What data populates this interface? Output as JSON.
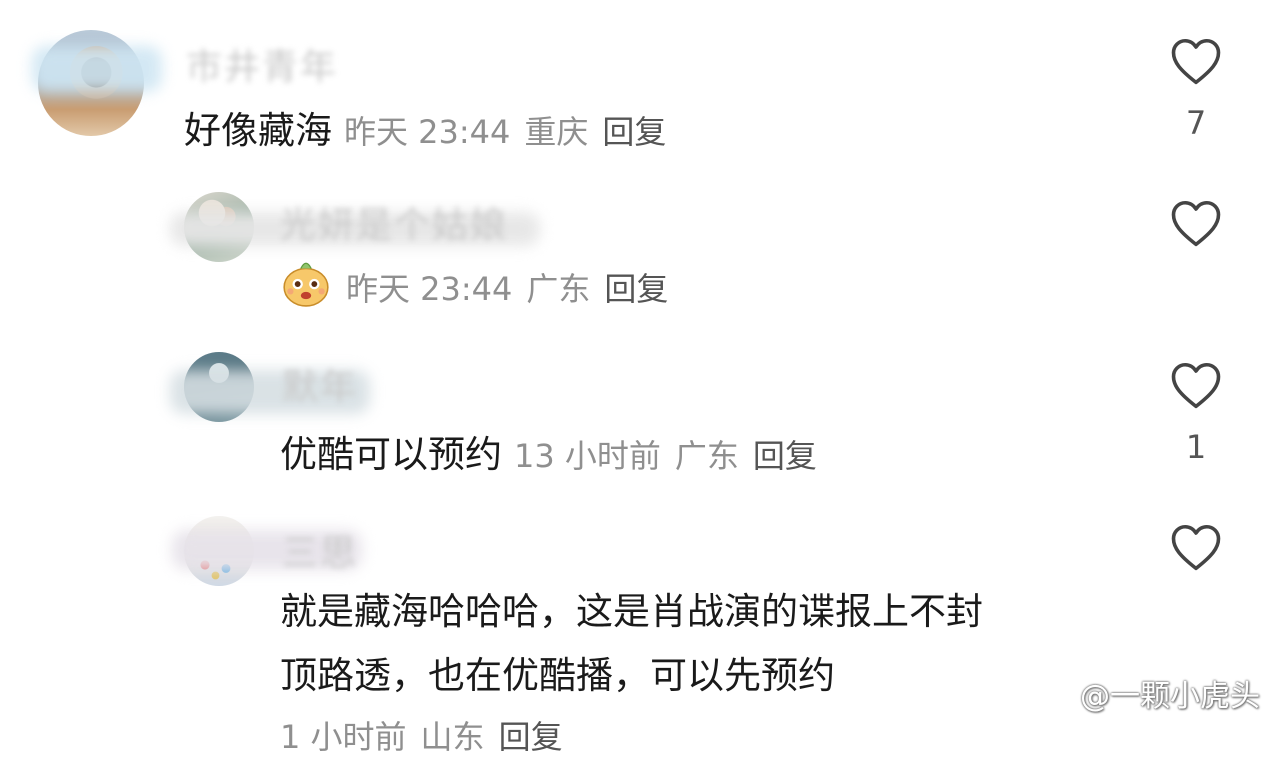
{
  "comments": [
    {
      "name_blurred": "市井青年",
      "text": "好像藏海",
      "time": "昨天 23:44",
      "location": "重庆",
      "reply_label": "回复",
      "likes": "7"
    },
    {
      "name_blurred": "光妍是个姑娘",
      "text": "",
      "time": "昨天 23:44",
      "location": "广东",
      "reply_label": "回复",
      "likes": ""
    },
    {
      "name_blurred": "默年",
      "text": "优酷可以预约",
      "time": "13 小时前",
      "location": "广东",
      "reply_label": "回复",
      "likes": "1"
    },
    {
      "name_blurred": "三思",
      "text_line1": "就是藏海哈哈哈，这是肖战演的谍报上不封",
      "text_line2": "顶路透，也在优酷播，可以先预约",
      "time": "1 小时前",
      "location": "山东",
      "reply_label": "回复",
      "likes": ""
    }
  ],
  "watermark": "@一颗小虎头",
  "icons": {
    "like": "heart-outline-icon",
    "sticker": "cute-creature-sticker-icon",
    "watermark": "weibo-logo-icon"
  },
  "colors": {
    "text": "#1a1a1a",
    "meta": "#8f8f8f",
    "reply": "#555555",
    "heart": "#444444"
  }
}
